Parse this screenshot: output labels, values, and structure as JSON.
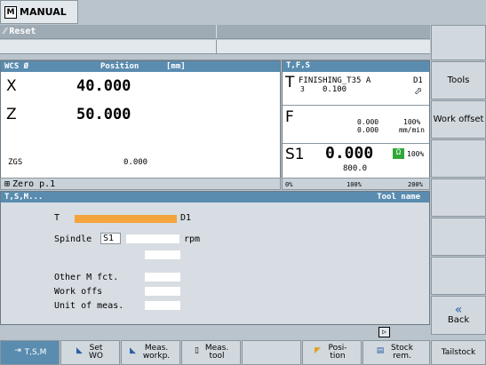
{
  "header": {
    "mode_icon": "M",
    "mode": "MANUAL"
  },
  "status": {
    "reset": "Reset"
  },
  "wcs": {
    "title": "WCS Ø",
    "position_label": "Position",
    "unit": "[mm]",
    "axes": [
      {
        "name": "X",
        "value": "40.000"
      },
      {
        "name": "Z",
        "value": "50.000"
      }
    ],
    "zgs_label": "ZGS",
    "zgs_value": "0.000",
    "zero_label": "Zero p.1"
  },
  "tfs": {
    "title": "T,F,S",
    "tool_name": "FINISHING_T35 A",
    "tool_d": "D1",
    "tool_num": "3",
    "tool_val": "0.100",
    "feed_actual": "0.000",
    "feed_set": "0.000",
    "feed_pct": "100%",
    "feed_unit": "mm/min",
    "spindle": "S1",
    "spindle_val": "0.000",
    "spindle_set": "800.0",
    "spindle_pct": "100%",
    "scale": [
      "0%",
      "100%",
      "200%"
    ]
  },
  "tsm": {
    "title": "T,S,M...",
    "tool_name_label": "Tool name",
    "t_label": "T",
    "d_label": "D1",
    "spindle_label": "Spindle",
    "spindle_select": "S1",
    "rpm_label": "rpm",
    "other_m": "Other M fct.",
    "work_offs": "Work offs",
    "unit_meas": "Unit of meas."
  },
  "right_softkeys": [
    "Tools",
    "Work offset",
    "Back"
  ],
  "bottom_softkeys": {
    "tsm": "T,S,M",
    "set_wo": "Set WO",
    "meas_workp": "Meas. workp.",
    "meas_tool": "Meas. tool",
    "position": "Posi- tion",
    "stock_rem": "Stock rem.",
    "tailstock": "Tailstock"
  },
  "colors": {
    "accent": "#5a8cb0",
    "tool_field": "#f4a43c",
    "background": "#b9c4cc"
  }
}
